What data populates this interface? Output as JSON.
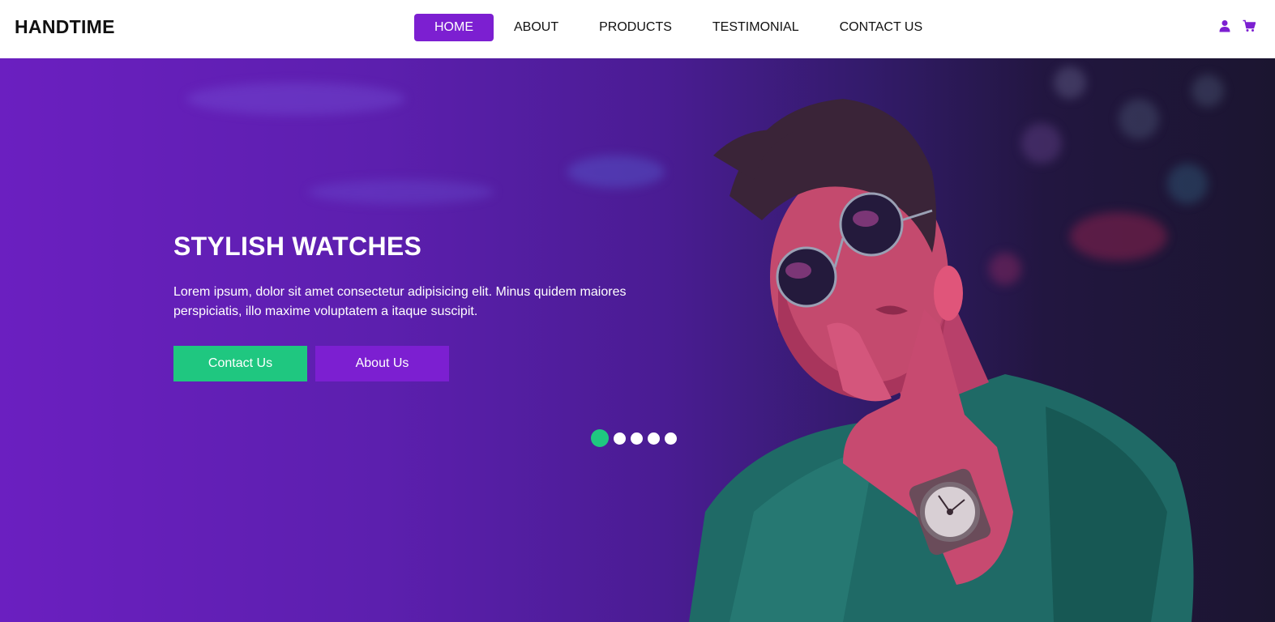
{
  "brand": {
    "name": "HANDTIME"
  },
  "nav": {
    "items": [
      {
        "label": "HOME",
        "active": true
      },
      {
        "label": "ABOUT",
        "active": false
      },
      {
        "label": "PRODUCTS",
        "active": false
      },
      {
        "label": "TESTIMONIAL",
        "active": false
      },
      {
        "label": "CONTACT US",
        "active": false
      }
    ]
  },
  "header_icons": [
    "user-icon",
    "cart-icon"
  ],
  "hero": {
    "title": "STYLISH WATCHES",
    "text": "Lorem ipsum, dolor sit amet consectetur adipisicing elit. Minus quidem maiores perspiciatis, illo maxime voluptatem a itaque suscipit.",
    "buttons": {
      "contact": "Contact Us",
      "about": "About Us"
    },
    "slider": {
      "count": 5,
      "active_index": 0
    }
  },
  "colors": {
    "accent": "#7c1fd1",
    "green": "#1fc780",
    "hero_start": "#6b1fc0",
    "hero_end": "#1b1530"
  }
}
